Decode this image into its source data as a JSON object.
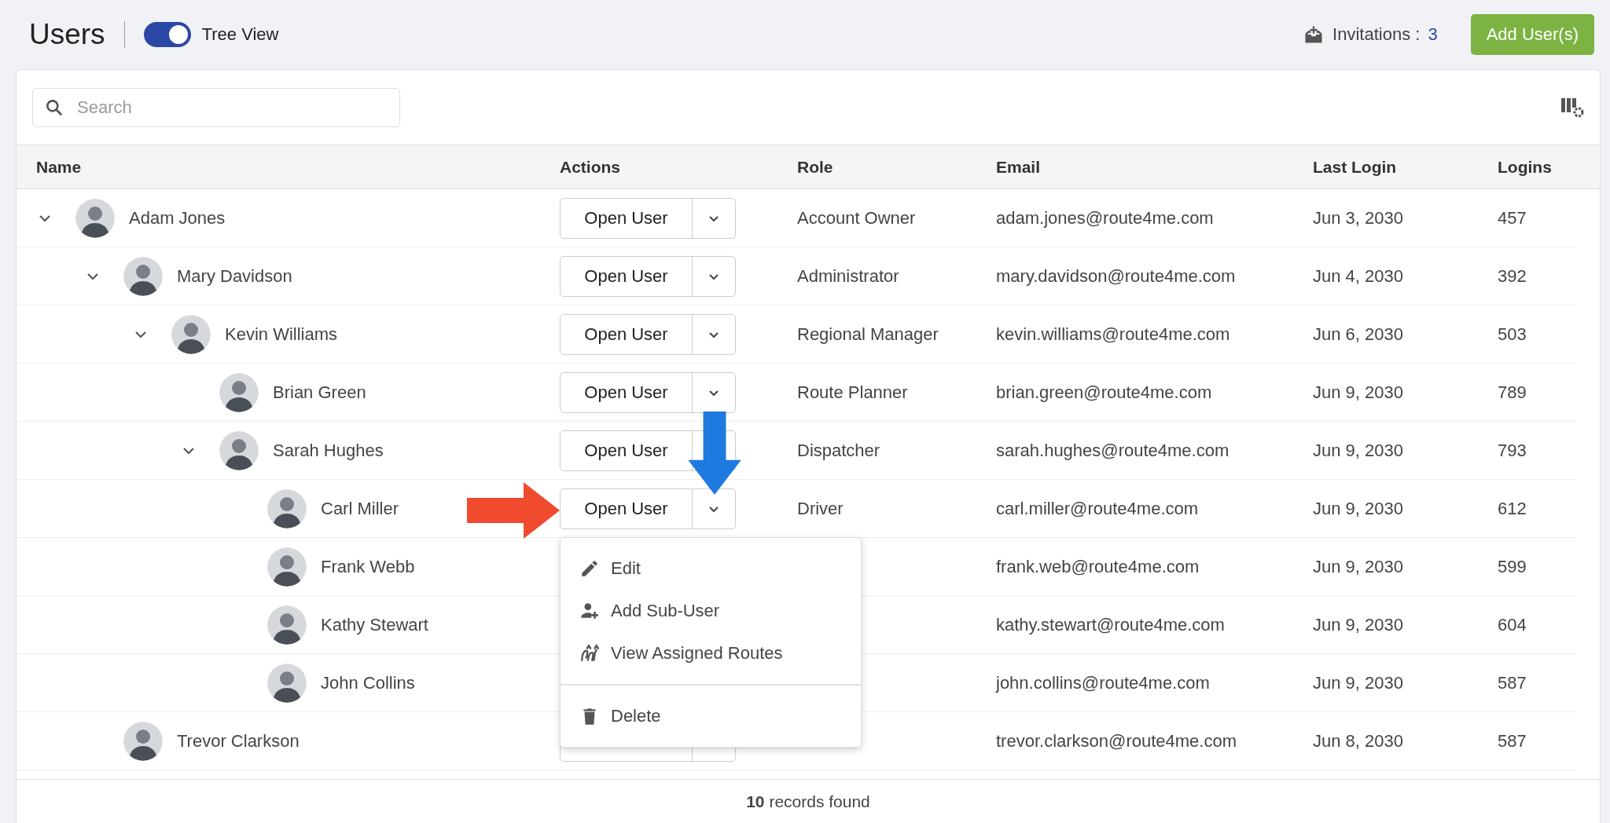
{
  "header": {
    "title": "Users",
    "toggle": {
      "label": "Tree View",
      "on": true
    },
    "invitations": {
      "label": "Invitations :",
      "count": "3"
    },
    "add_button": "Add User(s)"
  },
  "search": {
    "placeholder": "Search"
  },
  "table": {
    "columns": [
      "Name",
      "Actions",
      "Role",
      "Email",
      "Last Login",
      "Logins"
    ],
    "rows": [
      {
        "name": "Adam Jones",
        "expanded": true,
        "action": "Open User",
        "role": "Account Owner",
        "email": "adam.jones@route4me.com",
        "last_login": "Jun 3, 2030",
        "logins": "457",
        "children": [
          {
            "name": "Mary Davidson",
            "expanded": true,
            "action": "Open User",
            "role": "Administrator",
            "email": "mary.davidson@route4me.com",
            "last_login": "Jun 4, 2030",
            "logins": "392",
            "children": [
              {
                "name": "Kevin Williams",
                "expanded": true,
                "action": "Open User",
                "role": "Regional Manager",
                "email": "kevin.williams@route4me.com",
                "last_login": "Jun 6, 2030",
                "logins": "503",
                "children": [
                  {
                    "name": "Brian Green",
                    "action": "Open User",
                    "role": "Route Planner",
                    "email": "brian.green@route4me.com",
                    "last_login": "Jun 9, 2030",
                    "logins": "789"
                  },
                  {
                    "name": "Sarah Hughes",
                    "expanded": true,
                    "action": "Open User",
                    "role": "Dispatcher",
                    "email": "sarah.hughes@route4me.com",
                    "last_login": "Jun 9, 2030",
                    "logins": "793",
                    "children": [
                      {
                        "name": "Carl Miller",
                        "action": "Open User",
                        "role": "Driver",
                        "email": "carl.miller@route4me.com",
                        "last_login": "Jun 9, 2030",
                        "logins": "612",
                        "menu": {
                          "groups": [
                            [
                              {
                                "kind": "edit",
                                "label": "Edit"
                              },
                              {
                                "kind": "add-user",
                                "label": "Add Sub-User"
                              },
                              {
                                "kind": "routes",
                                "label": "View Assigned Routes"
                              }
                            ],
                            [
                              {
                                "kind": "delete",
                                "label": "Delete"
                              }
                            ]
                          ]
                        }
                      },
                      {
                        "name": "Frank Webb",
                        "email": "frank.web@route4me.com",
                        "last_login": "Jun 9, 2030",
                        "logins": "599"
                      },
                      {
                        "name": "Kathy Stewart",
                        "email": "kathy.stewart@route4me.com",
                        "last_login": "Jun 9, 2030",
                        "logins": "604"
                      },
                      {
                        "name": "John Collins",
                        "email": "john.collins@route4me.com",
                        "last_login": "Jun 9, 2030",
                        "logins": "587"
                      }
                    ]
                  }
                ]
              }
            ]
          },
          {
            "name": "Trevor Clarkson",
            "email": "trevor.clarkson@route4me.com",
            "last_login": "Jun 8, 2030",
            "logins": "587"
          }
        ]
      }
    ]
  },
  "footer": {
    "count": "10",
    "text": "records found"
  }
}
